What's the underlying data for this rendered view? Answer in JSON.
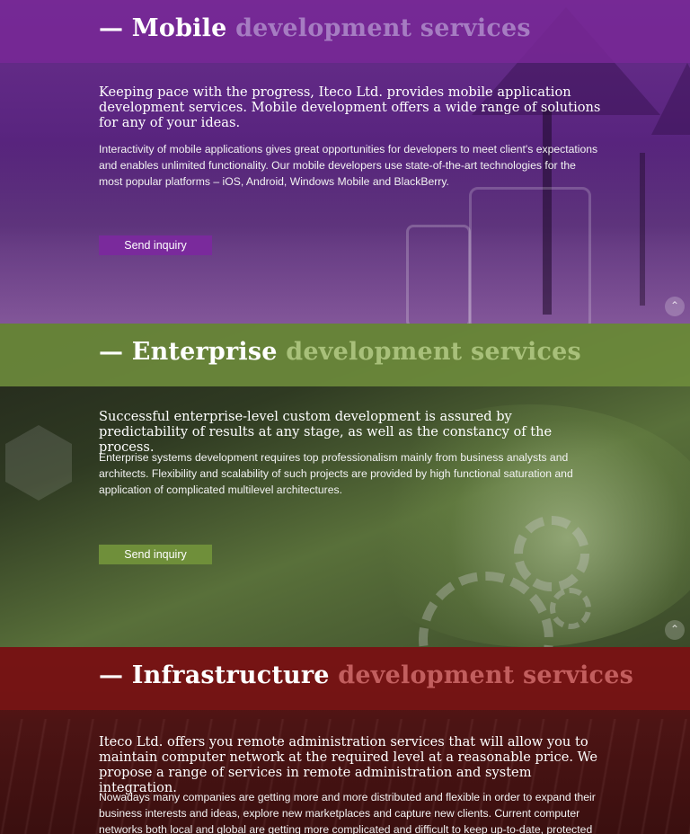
{
  "sections": {
    "mobile": {
      "title_main": "— Mobile",
      "title_sub": "development services",
      "lead": "Keeping pace with the progress, Iteco Ltd. provides mobile application development services. Mobile development offers a wide range of solutions for any of your ideas.",
      "body": "Interactivity of mobile applications gives great opportunities for developers to meet client's expectations and enables unlimited functionality. Our mobile developers use state-of-the-art technologies for the most popular platforms – iOS, Android, Windows Mobile and BlackBerry.",
      "button_label": "Send inquiry"
    },
    "enterprise": {
      "title_main": "— Enterprise",
      "title_sub": "development services",
      "lead": "Successful enterprise-level custom development is assured by predictability of results at any stage, as well as the constancy of the process.",
      "body": "Enterprise systems development requires top professionalism mainly from business analysts and architects. Flexibility and scalability of such projects are provided by high functional saturation and application of complicated multilevel architectures.",
      "button_label": "Send inquiry"
    },
    "infrastructure": {
      "title_main": "— Infrastructure",
      "title_sub": "development services",
      "lead": "Iteco Ltd. offers you remote administration services that will allow you to maintain computer network at the required level at a reasonable price. We propose a range of services in remote administration and system integration.",
      "body": "Nowadays many companies are getting more and more distributed and flexible in order to expand their business interests and ideas, explore new marketplaces and capture new clients. Current computer networks both local and global are getting more complicated and difficult to keep up-to-date, protected"
    }
  },
  "icons": {
    "scroll_up": "chevron-up-icon"
  },
  "colors": {
    "mobile_accent": "#7a2a9c",
    "enterprise_accent": "#6f8f3a",
    "infrastructure_accent": "#7a1a1a"
  }
}
